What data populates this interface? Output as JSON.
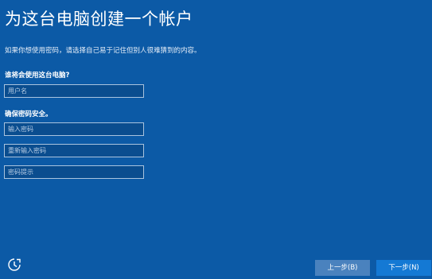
{
  "title": "为这台电脑创建一个帐户",
  "subtitle": "如果你想使用密码，请选择自己易于记住但别人很难猜到的内容。",
  "user_section": {
    "label": "谁将会使用这台电脑?",
    "username_placeholder": "用户名"
  },
  "password_section": {
    "label": "确保密码安全。",
    "password_placeholder": "输入密码",
    "confirm_placeholder": "重新输入密码",
    "hint_placeholder": "密码提示"
  },
  "footer": {
    "accessibility_icon": "ease-of-access-icon",
    "back_label": "上一步(B)",
    "next_label": "下一步(N)"
  }
}
